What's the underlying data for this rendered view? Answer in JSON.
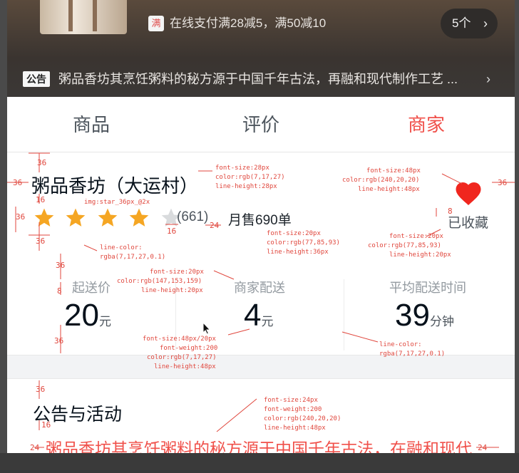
{
  "header": {
    "promo_tag": "满",
    "promo_text": "在线支付满28减5，满50减10",
    "promo_count": "5个",
    "notice_badge": "公告",
    "notice_text": "粥品香坊其烹饪粥料的秘方源于中国千年古法，再融和现代制作工艺 ..."
  },
  "tabs": [
    {
      "label": "商品",
      "active": false
    },
    {
      "label": "评价",
      "active": false
    },
    {
      "label": "商家",
      "active": true
    }
  ],
  "seller": {
    "name": "粥品香坊（大运村）",
    "rating_stars": 4,
    "rating_max": 5,
    "rating_count": "(661)",
    "monthly_sales": "月售690单",
    "favorite_label": "已收藏",
    "favorited": true
  },
  "stats": [
    {
      "label": "起送价",
      "value": "20",
      "unit": "元"
    },
    {
      "label": "商家配送",
      "value": "4",
      "unit": "元"
    },
    {
      "label": "平均配送时间",
      "value": "39",
      "unit": "分钟"
    }
  ],
  "section": {
    "title": "公告与活动",
    "notice": "粥品香坊其烹饪粥料的秘方源于中国千年古法，在融和现代"
  },
  "colors": {
    "accent": "#f0504a",
    "annotation": "#e0463c",
    "primary_text": "#07111b",
    "secondary_text": "#4d555d",
    "muted_text": "#939aa0",
    "star": "#f5a623"
  },
  "annotations": {
    "name_spec": [
      "font-size:28px",
      "color:rgb(7,17,27)",
      "line-height:28px"
    ],
    "heart_spec": [
      "font-size:48px",
      "color:rgb(240,20,20)",
      "line-height:48px"
    ],
    "star_spec": "img:star_36px_@2x",
    "line_spec_1": [
      "line-color:",
      "rgba(7,17,27,0.1)"
    ],
    "rating_spec": [
      "font-size:20px",
      "color:rgb(77,85,93)",
      "line-height:36px"
    ],
    "fav_spec": [
      "font-size:20px",
      "color:rgb(77,85,93)",
      "line-height:20px"
    ],
    "label_spec": [
      "font-size:20px",
      "color:rgb(147,153,159)",
      "line-height:20px"
    ],
    "value_spec": [
      "font-size:48px/20px",
      "font-weight:200",
      "color:rgb(7,17,27)",
      "line-height:48px"
    ],
    "line_spec_2": [
      "line-color:",
      "rgba(7,17,27,0.1)"
    ],
    "notice_spec": [
      "font-size:24px",
      "font-weight:200",
      "color:rgb(240,20,20)",
      "line-height:48px"
    ],
    "dims": {
      "d36_top": "36",
      "d36_left": "36",
      "d36_right": "36",
      "d16_a": "16",
      "d36_b": "36",
      "d36_c": "36",
      "d16_b": "16",
      "d24_a": "24",
      "d8": "8",
      "d36_d": "36",
      "d8_b": "8",
      "d36_e": "36",
      "d36_f": "36",
      "d16_c": "16",
      "d24_b": "24",
      "d24_c": "24"
    }
  }
}
